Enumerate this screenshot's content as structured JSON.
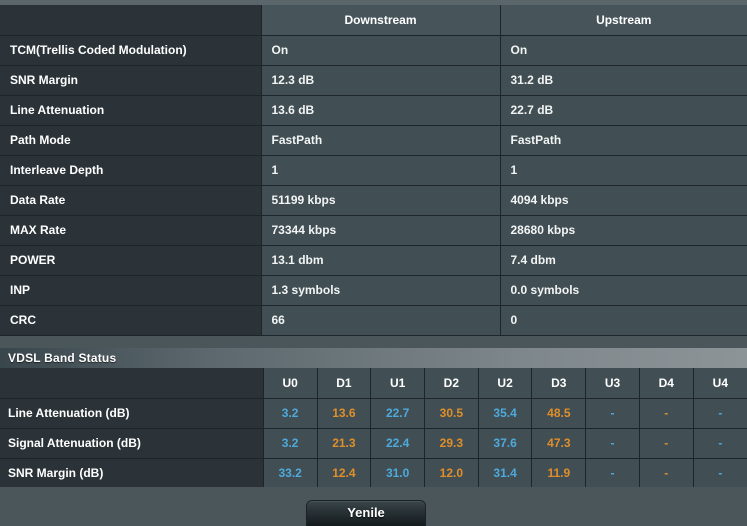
{
  "status_table": {
    "headers": [
      "",
      "Downstream",
      "Upstream"
    ],
    "rows": [
      {
        "label": "TCM(Trellis Coded Modulation)",
        "downstream": "On",
        "upstream": "On"
      },
      {
        "label": "SNR Margin",
        "downstream": "12.3 dB",
        "upstream": "31.2 dB"
      },
      {
        "label": "Line Attenuation",
        "downstream": "13.6 dB",
        "upstream": "22.7 dB"
      },
      {
        "label": "Path Mode",
        "downstream": "FastPath",
        "upstream": "FastPath"
      },
      {
        "label": "Interleave Depth",
        "downstream": "1",
        "upstream": "1"
      },
      {
        "label": "Data Rate",
        "downstream": "51199 kbps",
        "upstream": "4094 kbps"
      },
      {
        "label": "MAX Rate",
        "downstream": "73344 kbps",
        "upstream": "28680 kbps"
      },
      {
        "label": "POWER",
        "downstream": "13.1 dbm",
        "upstream": "7.4 dbm"
      },
      {
        "label": "INP",
        "downstream": "1.3 symbols",
        "upstream": "0.0 symbols"
      },
      {
        "label": "CRC",
        "downstream": "66",
        "upstream": "0"
      }
    ]
  },
  "band_section": {
    "title": "VDSL Band Status",
    "band_headers": [
      "U0",
      "D1",
      "U1",
      "D2",
      "U2",
      "D3",
      "U3",
      "D4",
      "U4"
    ],
    "band_directions": [
      "up",
      "down",
      "up",
      "down",
      "up",
      "down",
      "up",
      "down",
      "up"
    ],
    "rows": [
      {
        "label": "Line Attenuation (dB)",
        "values": [
          "3.2",
          "13.6",
          "22.7",
          "30.5",
          "35.4",
          "48.5",
          "-",
          "-",
          "-"
        ]
      },
      {
        "label": "Signal Attenuation (dB)",
        "values": [
          "3.2",
          "21.3",
          "22.4",
          "29.3",
          "37.6",
          "47.3",
          "-",
          "-",
          "-"
        ]
      },
      {
        "label": "SNR Margin (dB)",
        "values": [
          "33.2",
          "12.4",
          "31.0",
          "12.0",
          "31.4",
          "11.9",
          "-",
          "-",
          "-"
        ]
      }
    ]
  },
  "footer": {
    "refresh_label": "Yenile"
  },
  "colors": {
    "upstream_value": "#4ea9dc",
    "downstream_value": "#e08e2a",
    "label_cell_bg": "#2b3338",
    "value_cell_bg": "#414f54",
    "page_bg": "#4b565b"
  }
}
